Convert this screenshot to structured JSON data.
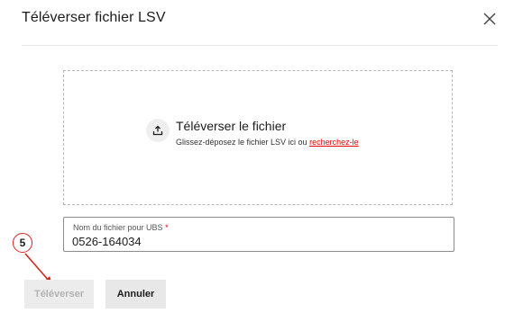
{
  "dialog": {
    "title": "Téléverser fichier LSV",
    "close_icon": "close-icon"
  },
  "dropzone": {
    "icon": "upload-icon",
    "title": "Téléverser le fichier",
    "hint": "Glissez-déposez le fichier LSV ici ou",
    "browse_link": "recherchez-le"
  },
  "filename_field": {
    "label": "Nom du fichier pour UBS",
    "required_marker": "*",
    "value": "0526-164034"
  },
  "annotation": {
    "step_number": "5",
    "color": "#d0271d"
  },
  "buttons": {
    "upload_label": "Téléverser",
    "upload_disabled": true,
    "cancel_label": "Annuler"
  },
  "colors": {
    "accent": "#e60000",
    "text": "#1c1c1c",
    "disabled_text": "#b3b3b3"
  }
}
